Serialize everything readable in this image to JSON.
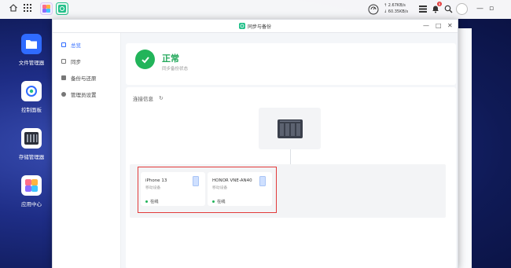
{
  "topbar": {
    "upload_speed": "↑ 2.67KB/s",
    "download_speed": "↓ 60.35KB/s",
    "notification_badge": "9"
  },
  "desktop": {
    "apps": [
      {
        "label": "文件管理器"
      },
      {
        "label": "控制面板"
      },
      {
        "label": "存储管理器"
      },
      {
        "label": "应用中心"
      }
    ]
  },
  "window": {
    "title": "同步与备份"
  },
  "sidebar": {
    "items": [
      {
        "label": "总览",
        "active": true
      },
      {
        "label": "同步"
      },
      {
        "label": "备份与还原"
      },
      {
        "label": "管理员设置"
      }
    ]
  },
  "status": {
    "title": "正常",
    "subtitle": "同步备份状态"
  },
  "connection": {
    "title": "连接信息",
    "devices": [
      {
        "name": "iPhone 13",
        "type": "移动设备",
        "status": "在线"
      },
      {
        "name": "HONOR VNE-AN40",
        "type": "移动设备",
        "status": "在线"
      }
    ]
  },
  "colors": {
    "accent": "#2f6bff",
    "success": "#22b45a",
    "highlight": "#e23a3a"
  }
}
